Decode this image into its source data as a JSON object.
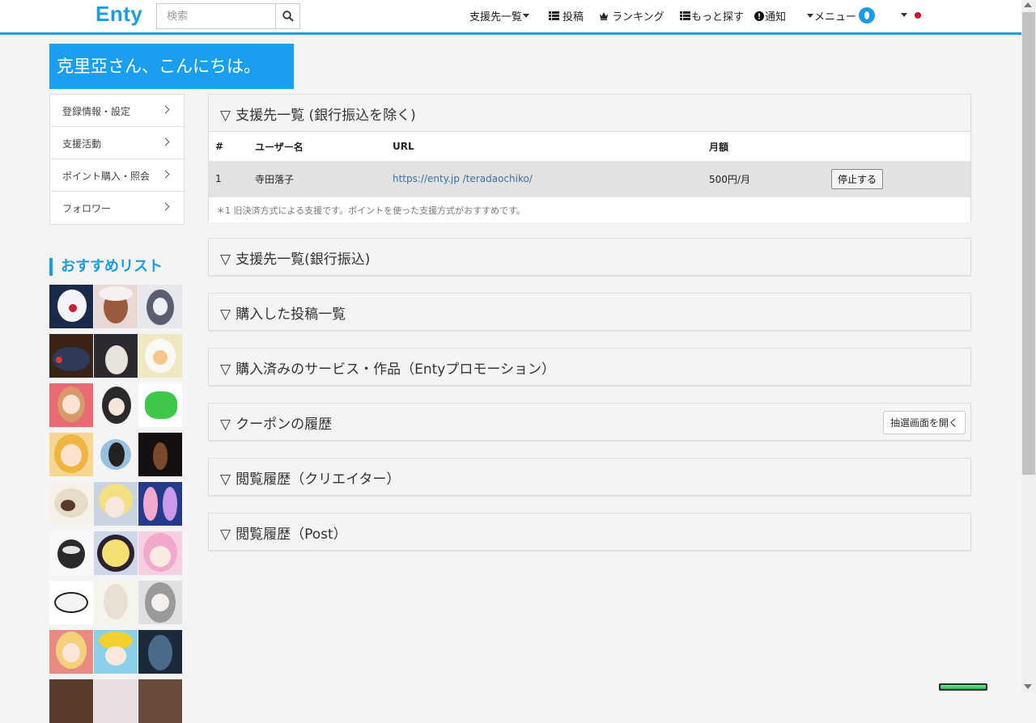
{
  "header": {
    "logo": "Enty",
    "search_placeholder": "検索",
    "nav": {
      "support_list": "支援先一覧",
      "post": "投稿",
      "ranking": "ランキング",
      "more": "もっと探す",
      "notifications": "通知",
      "menu": "メニュー"
    },
    "accent_color": "#1a9be6"
  },
  "greeting": "克里亞さん、こんにちは。",
  "sidebar": {
    "items": [
      {
        "label": "登録情報・設定"
      },
      {
        "label": "支援活動"
      },
      {
        "label": "ポイント購入・照会"
      },
      {
        "label": "フォロワー"
      }
    ],
    "recommend_title": "おすすめリスト"
  },
  "panels": {
    "bank_excluded": {
      "title": "支援先一覧 (銀行振込を除く)",
      "columns": [
        "#",
        "ユーザー名",
        "URL",
        "月額"
      ],
      "rows": [
        {
          "num": "1",
          "user": "寺田落子",
          "url": "https://enty.jp /teradaochiko/",
          "amount": "500円/月",
          "action": "停止する"
        }
      ],
      "note": "＊1 旧決済方式による支援です。ポイントを使った支援方式がおすすめです。"
    },
    "bank": {
      "title": "支援先一覧(銀行振込)"
    },
    "purchased_posts": {
      "title": "購入した投稿一覧"
    },
    "purchased_services": {
      "title": "購入済みのサービス・作品（Entyプロモーション）"
    },
    "coupons": {
      "title": "クーポンの履歴",
      "button": "抽選画面を開く"
    },
    "history_creators": {
      "title": "閲覧履歴（クリエイター）"
    },
    "history_posts": {
      "title": "閲覧履歴（Post）"
    }
  },
  "collapse_glyph": "▽"
}
